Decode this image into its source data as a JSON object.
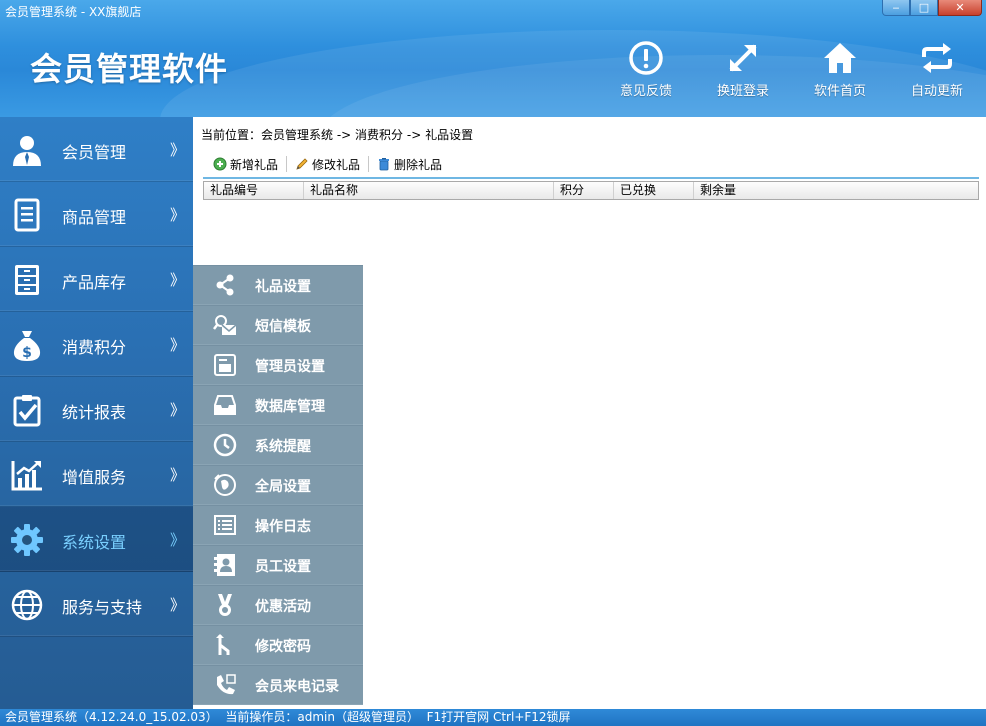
{
  "window": {
    "title": "会员管理系统 - XX旗舰店",
    "controls": {
      "minimize": "‒",
      "maximize": "□",
      "close": "✕"
    }
  },
  "header": {
    "app_title": "会员管理软件",
    "tools": [
      {
        "label": "意见反馈",
        "icon": "feedback-icon"
      },
      {
        "label": "换班登录",
        "icon": "expand-arrows-icon"
      },
      {
        "label": "软件首页",
        "icon": "home-icon"
      },
      {
        "label": "自动更新",
        "icon": "refresh-icon"
      }
    ]
  },
  "sidebar": {
    "arrow": "》",
    "items": [
      {
        "label": "会员管理",
        "icon": "member-icon"
      },
      {
        "label": "商品管理",
        "icon": "document-icon"
      },
      {
        "label": "产品库存",
        "icon": "cabinet-icon"
      },
      {
        "label": "消费积分",
        "icon": "money-bag-icon"
      },
      {
        "label": "统计报表",
        "icon": "clipboard-check-icon"
      },
      {
        "label": "增值服务",
        "icon": "growth-chart-icon"
      },
      {
        "label": "系统设置",
        "icon": "gear-icon",
        "active": true
      },
      {
        "label": "服务与支持",
        "icon": "globe-icon"
      }
    ]
  },
  "submenu": {
    "items": [
      {
        "label": "礼品设置",
        "icon": "share-icon"
      },
      {
        "label": "短信模板",
        "icon": "search-mail-icon"
      },
      {
        "label": "管理员设置",
        "icon": "admin-card-icon"
      },
      {
        "label": "数据库管理",
        "icon": "inbox-tray-icon"
      },
      {
        "label": "系统提醒",
        "icon": "clock-icon"
      },
      {
        "label": "全局设置",
        "icon": "globe-refresh-icon"
      },
      {
        "label": "操作日志",
        "icon": "log-list-icon"
      },
      {
        "label": "员工设置",
        "icon": "contact-book-icon"
      },
      {
        "label": "优惠活动",
        "icon": "ribbon-award-icon"
      },
      {
        "label": "修改密码",
        "icon": "branch-arrow-icon"
      },
      {
        "label": "会员来电记录",
        "icon": "phone-record-icon"
      }
    ]
  },
  "main": {
    "breadcrumb": {
      "prefix": "当前位置：",
      "path": [
        "会员管理系统",
        "消费积分",
        "礼品设置"
      ],
      "separator": " -> "
    },
    "toolbar": {
      "add": "新增礼品",
      "edit": "修改礼品",
      "delete": "删除礼品"
    },
    "table": {
      "columns": [
        "礼品编号",
        "礼品名称",
        "积分",
        "已兑换",
        "剩余量"
      ],
      "rows": []
    }
  },
  "statusbar": {
    "version": "会员管理系统（4.12.24.0_15.02.03）",
    "operator": "当前操作员：admin（超级管理员）",
    "hint_f1": "F1打开官网",
    "hint_lock": "Ctrl+F12锁屏"
  },
  "colors": {
    "header_blue": "#2e8fdd",
    "sidebar_blue": "#2a6fb2",
    "submenu_gray": "#7f9aab",
    "active_text": "#7ad0ff",
    "accent_line": "#6fb7e3"
  }
}
